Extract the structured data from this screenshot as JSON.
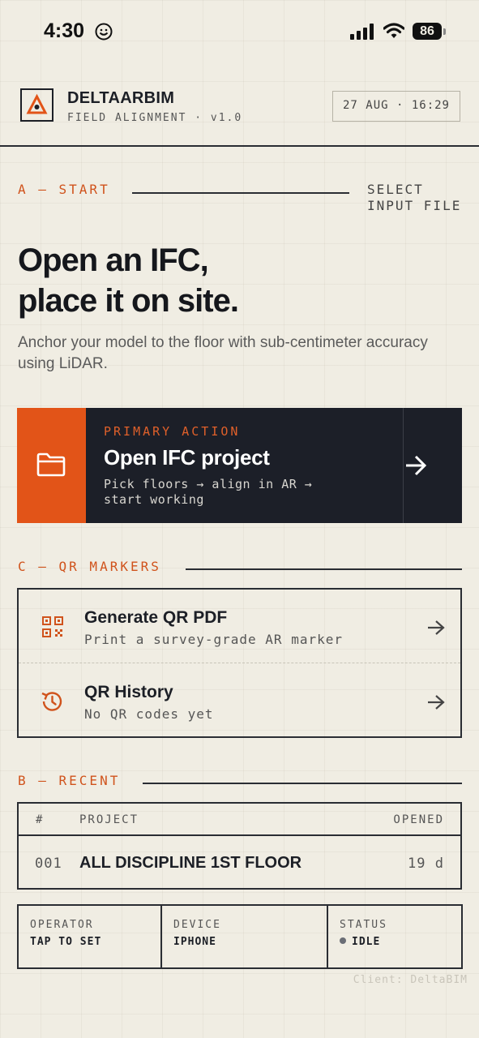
{
  "status_bar": {
    "time": "4:30",
    "battery": "86"
  },
  "header": {
    "brand": "DELTAARBIM",
    "subtitle": "FIELD ALIGNMENT · v1.0",
    "datetime": "27 AUG · 16:29"
  },
  "start_section": {
    "label": "A — START",
    "side_label_line1": "SELECT",
    "side_label_line2": "INPUT FILE",
    "title_line1": "Open an IFC,",
    "title_line2": "place it on site.",
    "description": "Anchor your model to the floor with sub-centimeter accuracy using LiDAR."
  },
  "primary_action": {
    "kicker": "PRIMARY ACTION",
    "title": "Open IFC project",
    "desc_line1": "Pick floors → align in AR →",
    "desc_line2": "start working",
    "icon": "folder-icon"
  },
  "qr_section": {
    "label": "C — QR MARKERS",
    "items": [
      {
        "title": "Generate QR PDF",
        "subtitle": "Print a survey-grade AR marker",
        "icon": "qr-code-icon"
      },
      {
        "title": "QR History",
        "subtitle": "No QR codes yet",
        "icon": "history-icon"
      }
    ]
  },
  "recent_section": {
    "label": "B — RECENT",
    "columns": {
      "num": "#",
      "project": "PROJECT",
      "opened": "OPENED"
    },
    "rows": [
      {
        "num": "001",
        "project": "ALL DISCIPLINE 1ST FLOOR",
        "opened": "19 d"
      }
    ]
  },
  "info_bar": {
    "operator_label": "OPERATOR",
    "operator_value": "TAP TO SET",
    "device_label": "DEVICE",
    "device_value": "IPHONE",
    "status_label": "STATUS",
    "status_value": "IDLE"
  },
  "footer": {
    "client": "Client: DeltaBIM"
  },
  "colors": {
    "accent": "#e25418",
    "dark": "#1c1f28",
    "background": "#f0ede3"
  }
}
